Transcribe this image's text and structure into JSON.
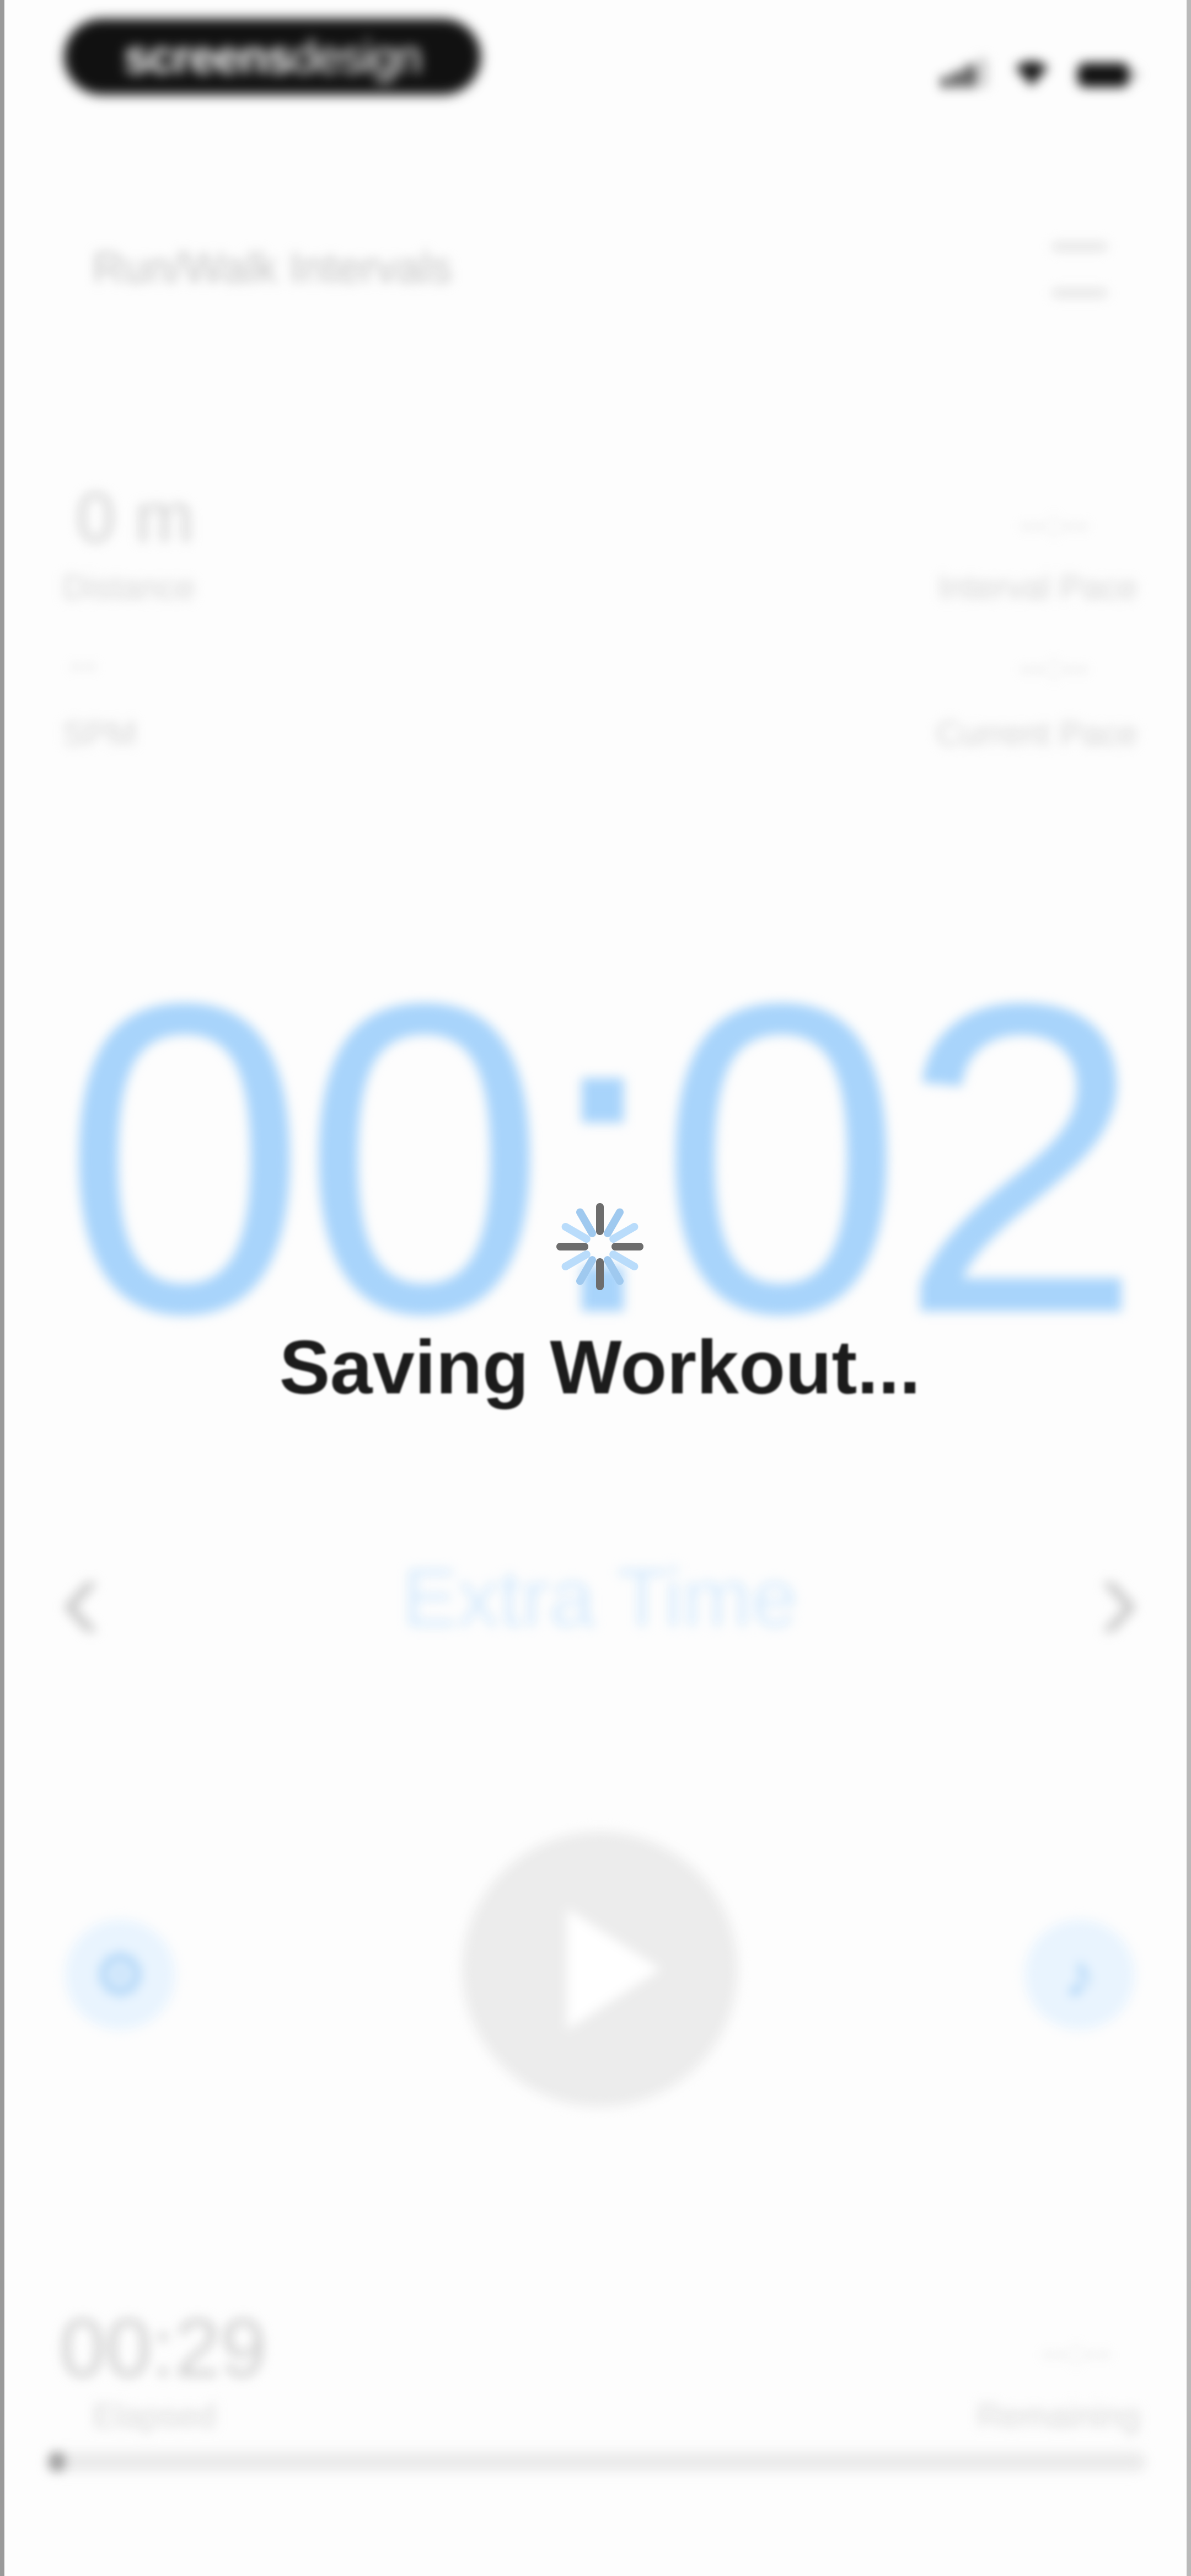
{
  "status_bar": {
    "brand_bold": "screens",
    "brand_light": "design",
    "signal_icon": "signal-icon",
    "wifi_icon": "wifi-icon",
    "battery_icon": "battery-icon"
  },
  "header": {
    "title": "Run/Walk Intervals",
    "menu_icon": "menu-icon"
  },
  "stats": {
    "distance_value": "0 m",
    "distance_label": "Distance",
    "spm_value": "--",
    "spm_label": "SPM",
    "interval_pace_value": "--:--",
    "interval_pace_label": "Interval Pace",
    "current_pace_value": "--:--",
    "current_pace_label": "Current Pace"
  },
  "timer": {
    "value": "00:02"
  },
  "interval": {
    "label": "Extra Time",
    "prev_icon": "chevron-left-icon",
    "next_icon": "chevron-right-icon"
  },
  "controls": {
    "settings_icon": "gear-icon",
    "play_icon": "play-icon",
    "music_icon": "music-note-icon"
  },
  "footer": {
    "elapsed_value": "00:29",
    "elapsed_label": "Elapsed",
    "remaining_value": "--:--",
    "remaining_label": "Remaining",
    "progress_percent": 1
  },
  "overlay": {
    "message": "Saving Workout...",
    "spinner_icon": "spinner-icon"
  },
  "colors": {
    "accent": "#a8d4fb",
    "overlay_text": "#1c1c1c"
  }
}
